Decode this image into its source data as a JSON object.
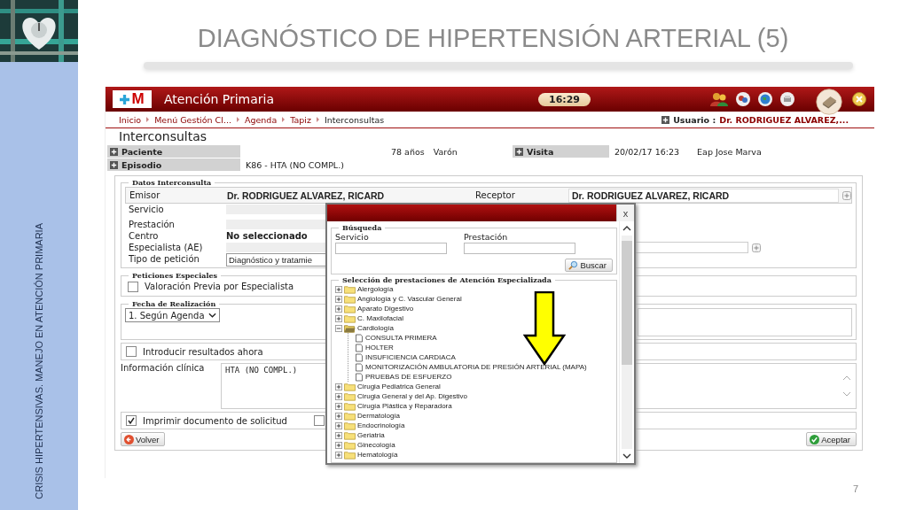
{
  "slide": {
    "title": "DIAGNÓSTICO DE HIPERTENSIÓN ARTERIAL (5)",
    "side_text": "CRISIS HIPERTENSIVAS. MANEJO EN ATENCIÓN PRIMARIA",
    "page_number": "7"
  },
  "app": {
    "logo": "M",
    "title": "Atención Primaria",
    "time": "16:29",
    "breadcrumb": [
      {
        "label": "Inicio"
      },
      {
        "label": "Menú Gestión Cl..."
      },
      {
        "label": "Agenda"
      },
      {
        "label": "Tapiz"
      },
      {
        "label": "Interconsultas"
      }
    ],
    "user_label": "Usuario :",
    "user_name": "Dr. RODRIGUEZ ALVAREZ,...",
    "page_title": "Interconsultas",
    "patient": {
      "paciente_label": "Paciente",
      "age": "78 años",
      "sex": "Varón",
      "visita_label": "Visita",
      "visit_date": "20/02/17 16:23",
      "visit_place": "Eap Jose Marva",
      "episodio_label": "Episodio",
      "episode": "K86 - HTA (NO COMPL.)"
    },
    "datos": {
      "legend": "Datos Interconsulta",
      "emisor_label": "Emisor",
      "emisor": "Dr. RODRIGUEZ ALVAREZ, RICARD",
      "receptor_label": "Receptor",
      "receptor": "Dr. RODRIGUEZ ALVAREZ, RICARD",
      "servicio_label": "Servicio",
      "prestacion_label": "Prestación",
      "centro_label": "Centro",
      "centro": "No seleccionado",
      "especialista_label": "Especialista (AE)",
      "tipo_label": "Tipo de petición",
      "tipo": "Diagnóstico y tratamie"
    },
    "peticiones": {
      "legend": "Peticiones Especiales",
      "label": "Valoración Previa por Especialista",
      "checked": false
    },
    "fecha": {
      "legend": "Fecha de Realización",
      "value": "1. Según Agenda"
    },
    "resultados": {
      "label": "Introducir resultados ahora",
      "checked": false
    },
    "clinica": {
      "label": "Información clínica",
      "value": "HTA  (NO COMPL.)"
    },
    "imprimir": [
      {
        "label": "Imprimir documento de solicitud",
        "checked": true
      },
      {
        "checked": false
      }
    ],
    "back": "Volver",
    "accept": "Aceptar"
  },
  "dialog": {
    "close": "x",
    "search_legend": "Búsqueda",
    "servicio_label": "Servicio",
    "prestacion_label": "Prestación",
    "search_button": "Buscar",
    "tree_legend": "Selección de prestaciones de Atención Especializada",
    "tree": [
      {
        "label": "Alergología",
        "expanded": false
      },
      {
        "label": "Angiología y C. Vascular General",
        "expanded": false
      },
      {
        "label": "Aparato Digestivo",
        "expanded": false
      },
      {
        "label": "C. Maxilofacial",
        "expanded": false
      },
      {
        "label": "Cardiología",
        "expanded": true,
        "children": [
          {
            "label": "CONSULTA PRIMERA"
          },
          {
            "label": "HOLTER"
          },
          {
            "label": "INSUFICIENCIA CARDIACA"
          },
          {
            "label": "MONITORIZACIÓN AMBULATORIA DE PRESIÓN ARTERIAL (MAPA)"
          },
          {
            "label": "PRUEBAS DE ESFUERZO"
          }
        ]
      },
      {
        "label": "Cirugia Pediatrica General",
        "expanded": false
      },
      {
        "label": "Cirugia General y del Ap. Digestivo",
        "expanded": false
      },
      {
        "label": "Cirugía Plástica y Reparadora",
        "expanded": false
      },
      {
        "label": "Dermatología",
        "expanded": false
      },
      {
        "label": "Endocrinología",
        "expanded": false
      },
      {
        "label": "Geriatria",
        "expanded": false
      },
      {
        "label": "Ginecología",
        "expanded": false
      },
      {
        "label": "Hematología",
        "expanded": false
      }
    ]
  }
}
